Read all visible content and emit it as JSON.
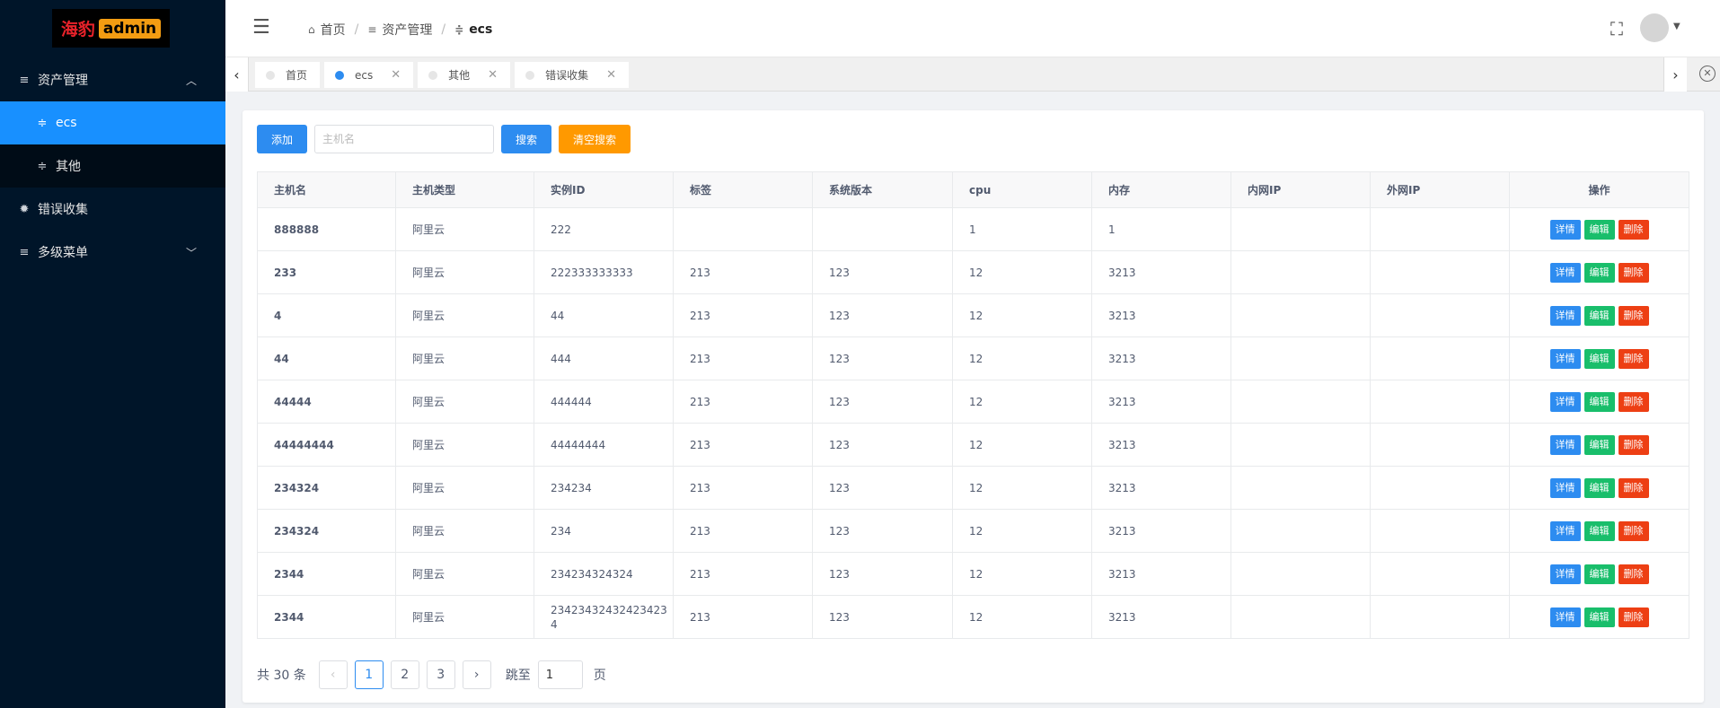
{
  "logo": {
    "cn": "海豹",
    "en": "admin"
  },
  "sidebar": {
    "items": [
      {
        "label": "资产管理",
        "icon": "menu-icon",
        "arrow": "chevron-up-icon"
      },
      {
        "label": "ecs",
        "icon": "filter-icon"
      },
      {
        "label": "其他",
        "icon": "filter-icon"
      },
      {
        "label": "错误收集",
        "icon": "bug-icon"
      },
      {
        "label": "多级菜单",
        "icon": "menu-icon",
        "arrow": "chevron-down-icon"
      }
    ]
  },
  "header": {
    "breadcrumb": [
      {
        "label": "首页",
        "icon": "home-icon"
      },
      {
        "label": "资产管理",
        "icon": "menu-icon"
      },
      {
        "label": "ecs",
        "icon": "filter-icon"
      }
    ]
  },
  "tabs": [
    {
      "label": "首页",
      "active": false,
      "closable": false
    },
    {
      "label": "ecs",
      "active": true,
      "closable": true
    },
    {
      "label": "其他",
      "active": false,
      "closable": true
    },
    {
      "label": "错误收集",
      "active": false,
      "closable": true
    }
  ],
  "toolbar": {
    "add_label": "添加",
    "search_placeholder": "主机名",
    "search_value": "",
    "search_label": "搜索",
    "clear_label": "清空搜索"
  },
  "table": {
    "columns": [
      "主机名",
      "主机类型",
      "实例ID",
      "标签",
      "系统版本",
      "cpu",
      "内存",
      "内网IP",
      "外网IP",
      "操作"
    ],
    "actions": {
      "detail": "详情",
      "edit": "编辑",
      "delete": "删除"
    },
    "rows": [
      [
        "888888",
        "阿里云",
        "222",
        "",
        "",
        "1",
        "1",
        "",
        ""
      ],
      [
        "233",
        "阿里云",
        "222333333333",
        "213",
        "123",
        "12",
        "3213",
        "",
        ""
      ],
      [
        "4",
        "阿里云",
        "44",
        "213",
        "123",
        "12",
        "3213",
        "",
        ""
      ],
      [
        "44",
        "阿里云",
        "444",
        "213",
        "123",
        "12",
        "3213",
        "",
        ""
      ],
      [
        "44444",
        "阿里云",
        "444444",
        "213",
        "123",
        "12",
        "3213",
        "",
        ""
      ],
      [
        "44444444",
        "阿里云",
        "44444444",
        "213",
        "123",
        "12",
        "3213",
        "",
        ""
      ],
      [
        "234324",
        "阿里云",
        "234234",
        "213",
        "123",
        "12",
        "3213",
        "",
        ""
      ],
      [
        "234324",
        "阿里云",
        "234",
        "213",
        "123",
        "12",
        "3213",
        "",
        ""
      ],
      [
        "2344",
        "阿里云",
        "234234324324",
        "213",
        "123",
        "12",
        "3213",
        "",
        ""
      ],
      [
        "2344",
        "阿里云",
        "234234324324234234",
        "213",
        "123",
        "12",
        "3213",
        "",
        ""
      ]
    ]
  },
  "pager": {
    "total": "共 30 条",
    "pages": [
      "1",
      "2",
      "3"
    ],
    "current": "1",
    "jump_label": "跳至",
    "jump_value": "1",
    "page_unit": "页"
  },
  "colors": {
    "sidebar_bg": "#001529",
    "active_menu": "#1890ff",
    "primary": "#2d8cf0",
    "warning": "#ff9900",
    "success": "#19be6b",
    "danger": "#ed3f14"
  }
}
